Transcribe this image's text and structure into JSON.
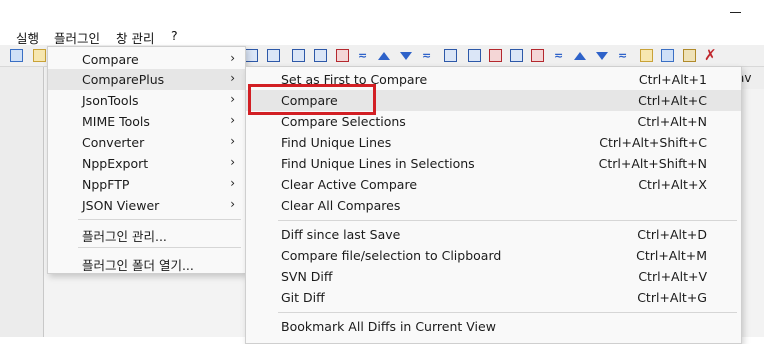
{
  "menubar": {
    "items": [
      "실행",
      "플러그인",
      "창 관리",
      "?"
    ]
  },
  "plugins_menu": {
    "items": [
      {
        "label": "Compare",
        "has_submenu": true
      },
      {
        "label": "ComparePlus",
        "has_submenu": true,
        "highlighted": true
      },
      {
        "label": "JsonTools",
        "has_submenu": true
      },
      {
        "label": "MIME Tools",
        "has_submenu": true
      },
      {
        "label": "Converter",
        "has_submenu": true
      },
      {
        "label": "NppExport",
        "has_submenu": true
      },
      {
        "label": "NppFTP",
        "has_submenu": true
      },
      {
        "label": "JSON Viewer",
        "has_submenu": true
      },
      {
        "label": "플러그인 관리..."
      },
      {
        "label": "플러그인 폴더 열기..."
      }
    ],
    "submenu_arrow": "›"
  },
  "compareplus_menu": {
    "items": [
      {
        "label": "Set as First to Compare",
        "shortcut": "Ctrl+Alt+1"
      },
      {
        "label": "Compare",
        "shortcut": "Ctrl+Alt+C",
        "highlighted": true
      },
      {
        "label": "Compare Selections",
        "shortcut": "Ctrl+Alt+N"
      },
      {
        "label": "Find Unique Lines",
        "shortcut": "Ctrl+Alt+Shift+C"
      },
      {
        "label": "Find Unique Lines in Selections",
        "shortcut": "Ctrl+Alt+Shift+N"
      },
      {
        "label": "Clear Active Compare",
        "shortcut": "Ctrl+Alt+X"
      },
      {
        "label": "Clear All Compares",
        "shortcut": ""
      },
      {
        "label": "Diff since last Save",
        "shortcut": "Ctrl+Alt+D"
      },
      {
        "label": "Compare file/selection to Clipboard",
        "shortcut": "Ctrl+Alt+M"
      },
      {
        "label": "SVN Diff",
        "shortcut": "Ctrl+Alt+V"
      },
      {
        "label": "Git Diff",
        "shortcut": "Ctrl+Alt+G"
      },
      {
        "label": "Bookmark All Diffs in Current View",
        "shortcut": ""
      }
    ]
  },
  "tab_fragment": "av",
  "colors": {
    "annotation_box": "#d21f24",
    "menu_background": "#f9f9f9",
    "highlight": "#e6e6e6",
    "toolbar_icon_blue": "#2e62c9"
  },
  "icons": [
    "minimize-icon",
    "toolbar-compare-icons",
    "red-x-icon",
    "chevron-right-icon"
  ]
}
